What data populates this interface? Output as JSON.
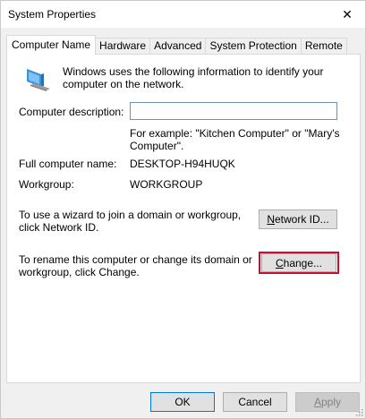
{
  "window": {
    "title": "System Properties",
    "close_glyph": "✕"
  },
  "tabs": [
    {
      "label": "Computer Name",
      "active": true
    },
    {
      "label": "Hardware",
      "active": false
    },
    {
      "label": "Advanced",
      "active": false
    },
    {
      "label": "System Protection",
      "active": false
    },
    {
      "label": "Remote",
      "active": false
    }
  ],
  "panel": {
    "intro": "Windows uses the following information to identify your computer on the network.",
    "description_label": "Computer description:",
    "description_value": "",
    "description_example": "For example: \"Kitchen Computer\" or \"Mary's Computer\".",
    "full_name_label": "Full computer name:",
    "full_name_value": "DESKTOP-H94HUQK",
    "workgroup_label": "Workgroup:",
    "workgroup_value": "WORKGROUP",
    "network_text": "To use a wizard to join a domain or workgroup, click Network ID.",
    "network_button": {
      "accel": "N",
      "rest": "etwork ID..."
    },
    "rename_text": "To rename this computer or change its domain or workgroup, click Change.",
    "change_button": {
      "accel": "C",
      "rest": "hange..."
    }
  },
  "footer": {
    "ok": "OK",
    "cancel": "Cancel",
    "apply": {
      "accel": "A",
      "rest": "pply"
    }
  },
  "colors": {
    "highlight": "#c8102e",
    "default_button_border": "#0078d7"
  },
  "icons": {
    "computer": "computer-icon",
    "close": "close-icon",
    "resize": "resize-grip-icon"
  }
}
